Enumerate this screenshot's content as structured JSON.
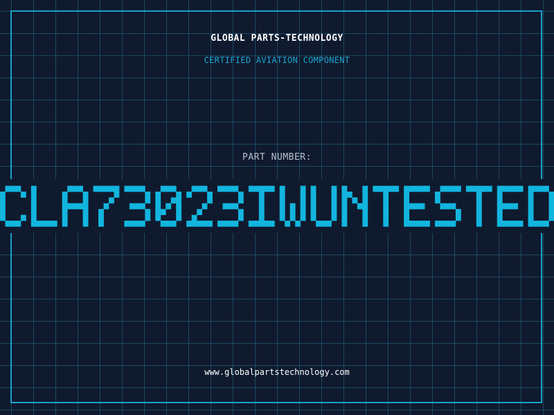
{
  "header": {
    "company": "GLOBAL PARTS-TECHNOLOGY",
    "subtitle": "CERTIFIED AVIATION COMPONENT"
  },
  "part": {
    "label": "PART NUMBER:",
    "number": "CLA73023IWUNTESTED"
  },
  "footer": {
    "url": "www.globalpartstechnology.com"
  },
  "colors": {
    "background": "#0f1a2e",
    "accent": "#18a3c9",
    "part_number": "#12b5de"
  }
}
